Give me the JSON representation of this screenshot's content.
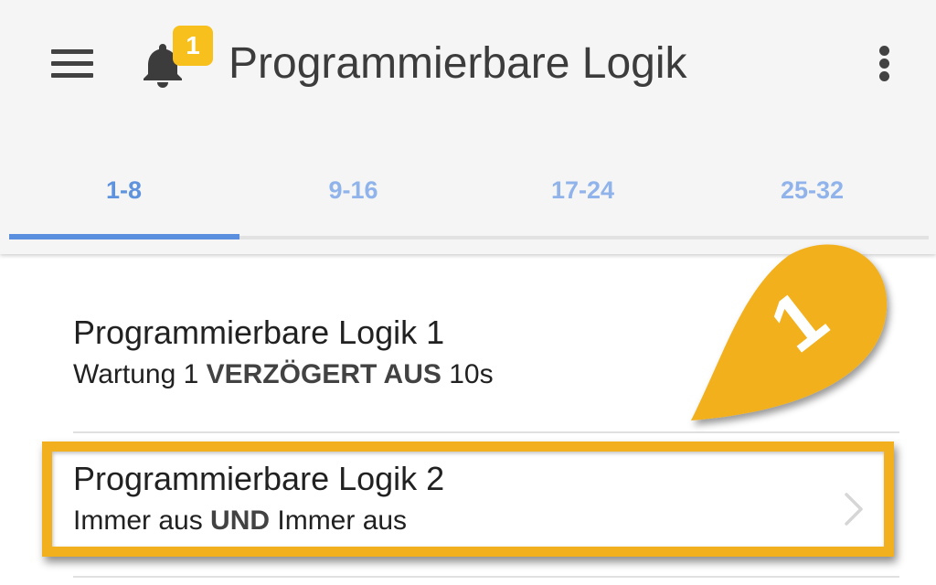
{
  "appbar": {
    "title": "Programmierbare Logik",
    "notification_count": "1",
    "icons": [
      "menu-icon",
      "bell-icon",
      "more-vert-icon"
    ]
  },
  "tabs": [
    {
      "label": "1-8",
      "active": true
    },
    {
      "label": "9-16",
      "active": false
    },
    {
      "label": "17-24",
      "active": false
    },
    {
      "label": "25-32",
      "active": false
    }
  ],
  "items": [
    {
      "title": "Programmierbare Logik 1",
      "sub_pre": "Wartung 1 ",
      "sub_bold": "VERZÖGERT AUS",
      "sub_post": " 10s"
    },
    {
      "title": "Programmierbare Logik 2",
      "sub_pre": "Immer aus ",
      "sub_bold": "UND",
      "sub_post": " Immer aus",
      "chevron": "chevron-right-icon"
    }
  ],
  "annotation": {
    "marker_label": "1",
    "color": "#f2b01e"
  },
  "colors": {
    "tab_accent": "#5a8fdf",
    "tab_inactive": "#8fb3ea",
    "badge": "#f7c01d"
  }
}
